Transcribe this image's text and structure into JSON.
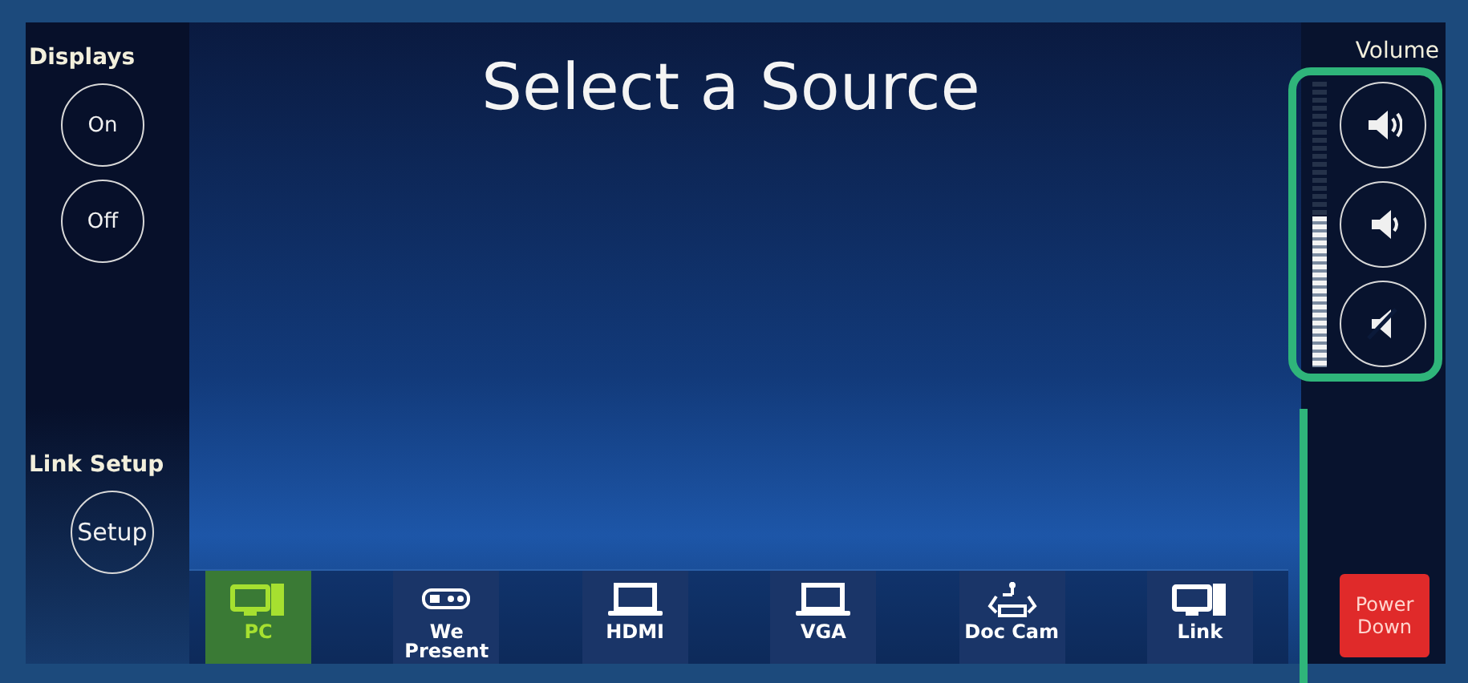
{
  "title": "Select a Source",
  "displays": {
    "label": "Displays",
    "buttons": [
      "On",
      "Off"
    ]
  },
  "link_setup": {
    "label": "Link Setup",
    "button": "Setup"
  },
  "volume": {
    "label": "Volume",
    "level": 0.53,
    "buttons": [
      {
        "kind": "up"
      },
      {
        "kind": "down"
      },
      {
        "kind": "mute"
      }
    ]
  },
  "sources": [
    {
      "label": "PC",
      "kind": "computer",
      "selected": true
    },
    {
      "label": "We Present",
      "kind": "wepresent",
      "selected": false
    },
    {
      "label": "HDMI",
      "kind": "laptop",
      "selected": false
    },
    {
      "label": "VGA",
      "kind": "laptop",
      "selected": false
    },
    {
      "label": "Doc Cam",
      "kind": "doccam",
      "selected": false
    },
    {
      "label": "Link",
      "kind": "computer",
      "selected": false
    }
  ],
  "power_button": "Power Down"
}
